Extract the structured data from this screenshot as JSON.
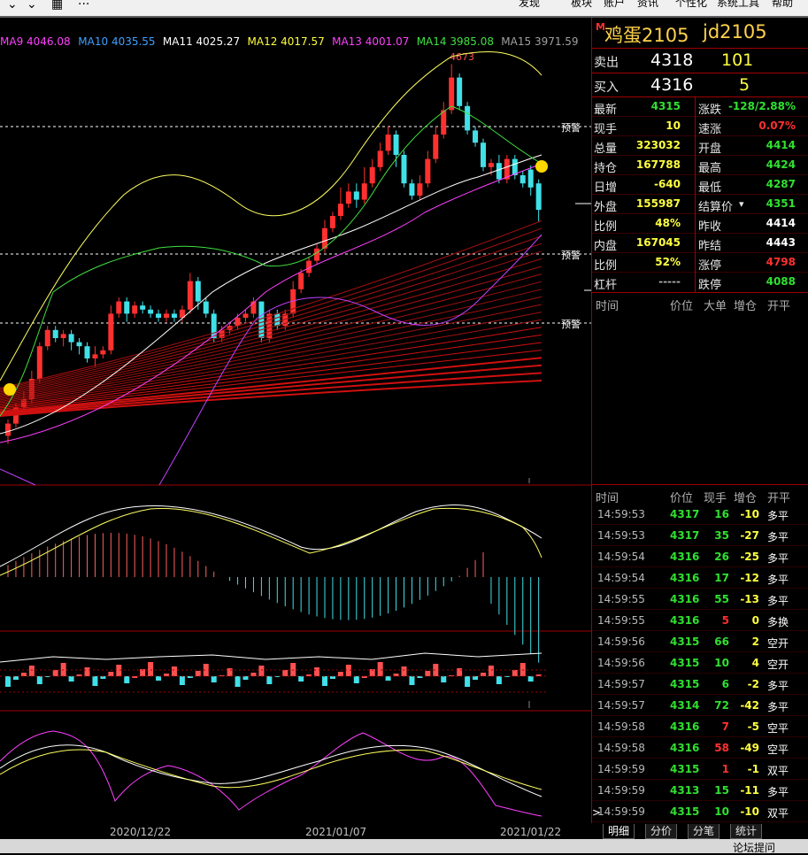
{
  "menu": {
    "items": [
      "发现",
      "板块",
      "账户",
      "资讯",
      "个性化",
      "系统工具",
      "帮助"
    ]
  },
  "ma_legend": [
    {
      "label": "MA9 4046.08",
      "color": "#ff40ff"
    },
    {
      "label": "MA10 4035.55",
      "color": "#40a0ff"
    },
    {
      "label": "MA11 4025.27",
      "color": "#ffffff"
    },
    {
      "label": "MA12 4017.57",
      "color": "#ffff40"
    },
    {
      "label": "MA13 4001.07",
      "color": "#ff40ff"
    },
    {
      "label": "MA14 3985.08",
      "color": "#40e040"
    },
    {
      "label": "MA15 3971.59",
      "color": "#a0a0a0"
    }
  ],
  "chart_annotations": {
    "high_label": "4673",
    "alert_label": "预警"
  },
  "dates": [
    "2020/12/22",
    "2021/01/07",
    "2021/01/22"
  ],
  "quote": {
    "prefix": "M",
    "name": "鸡蛋2105",
    "code": "jd2105",
    "ask_label": "卖出",
    "ask_price": "4318",
    "ask_vol": "101",
    "bid_label": "买入",
    "bid_price": "4316",
    "bid_vol": "5"
  },
  "stats": [
    {
      "l1": "最新",
      "v1": "4315",
      "c1": "g",
      "l2": "涨跌",
      "v2": "-128/2.88%",
      "c2": "g"
    },
    {
      "l1": "现手",
      "v1": "10",
      "c1": "y",
      "l2": "速涨",
      "v2": "0.07%",
      "c2": "r"
    },
    {
      "l1": "总量",
      "v1": "323032",
      "c1": "y",
      "l2": "开盘",
      "v2": "4414",
      "c2": "g"
    },
    {
      "l1": "持仓",
      "v1": "167788",
      "c1": "y",
      "l2": "最高",
      "v2": "4424",
      "c2": "g"
    },
    {
      "l1": "日增",
      "v1": "-640",
      "c1": "y",
      "l2": "最低",
      "v2": "4287",
      "c2": "g"
    },
    {
      "l1": "外盘",
      "v1": "155987",
      "c1": "y",
      "l2": "结算价",
      "v2": "4351",
      "c2": "g"
    },
    {
      "l1": "比例",
      "v1": "48%",
      "c1": "y",
      "l2": "昨收",
      "v2": "4414",
      "c2": "w"
    },
    {
      "l1": "内盘",
      "v1": "167045",
      "c1": "y",
      "l2": "昨结",
      "v2": "4443",
      "c2": "w"
    },
    {
      "l1": "比例",
      "v1": "52%",
      "c1": "y",
      "l2": "涨停",
      "v2": "4798",
      "c2": "r"
    },
    {
      "l1": "杠杆",
      "v1": "-----",
      "c1": "gr",
      "l2": "跌停",
      "v2": "4088",
      "c2": "g"
    }
  ],
  "big_header": [
    "时间",
    "价位",
    "大单",
    "增仓",
    "开平"
  ],
  "tick_header": [
    "时间",
    "价位",
    "现手",
    "增仓",
    "开平"
  ],
  "ticks": [
    {
      "t": "14:59:53",
      "p": "4317",
      "v": "16",
      "vc": "g",
      "d": "-10",
      "k": "多平"
    },
    {
      "t": "14:59:53",
      "p": "4317",
      "v": "35",
      "vc": "g",
      "d": "-27",
      "k": "多平"
    },
    {
      "t": "14:59:54",
      "p": "4316",
      "v": "26",
      "vc": "g",
      "d": "-25",
      "k": "多平"
    },
    {
      "t": "14:59:54",
      "p": "4316",
      "v": "17",
      "vc": "g",
      "d": "-12",
      "k": "多平"
    },
    {
      "t": "14:59:55",
      "p": "4316",
      "v": "55",
      "vc": "g",
      "d": "-13",
      "k": "多平"
    },
    {
      "t": "14:59:55",
      "p": "4316",
      "v": "5",
      "vc": "r",
      "d": "0",
      "k": "多换"
    },
    {
      "t": "14:59:56",
      "p": "4315",
      "v": "66",
      "vc": "g",
      "d": "2",
      "k": "空开"
    },
    {
      "t": "14:59:56",
      "p": "4315",
      "v": "10",
      "vc": "g",
      "d": "4",
      "k": "空开"
    },
    {
      "t": "14:59:57",
      "p": "4315",
      "v": "6",
      "vc": "g",
      "d": "-2",
      "k": "多平"
    },
    {
      "t": "14:59:57",
      "p": "4314",
      "v": "72",
      "vc": "g",
      "d": "-42",
      "k": "多平"
    },
    {
      "t": "14:59:58",
      "p": "4316",
      "v": "7",
      "vc": "r",
      "d": "-5",
      "k": "空平"
    },
    {
      "t": "14:59:58",
      "p": "4316",
      "v": "58",
      "vc": "r",
      "d": "-49",
      "k": "空平"
    },
    {
      "t": "14:59:59",
      "p": "4315",
      "v": "1",
      "vc": "r",
      "d": "-1",
      "k": "双平"
    },
    {
      "t": "14:59:59",
      "p": "4313",
      "v": "15",
      "vc": "g",
      "d": "-11",
      "k": "多平"
    },
    {
      "t": "14:59:59",
      "p": "4315",
      "v": "10",
      "vc": "g",
      "d": "-10",
      "k": "双平"
    }
  ],
  "tabs": [
    "明细",
    "分价",
    "分笔",
    "统计"
  ],
  "status": {
    "forum": "论坛提问"
  }
}
